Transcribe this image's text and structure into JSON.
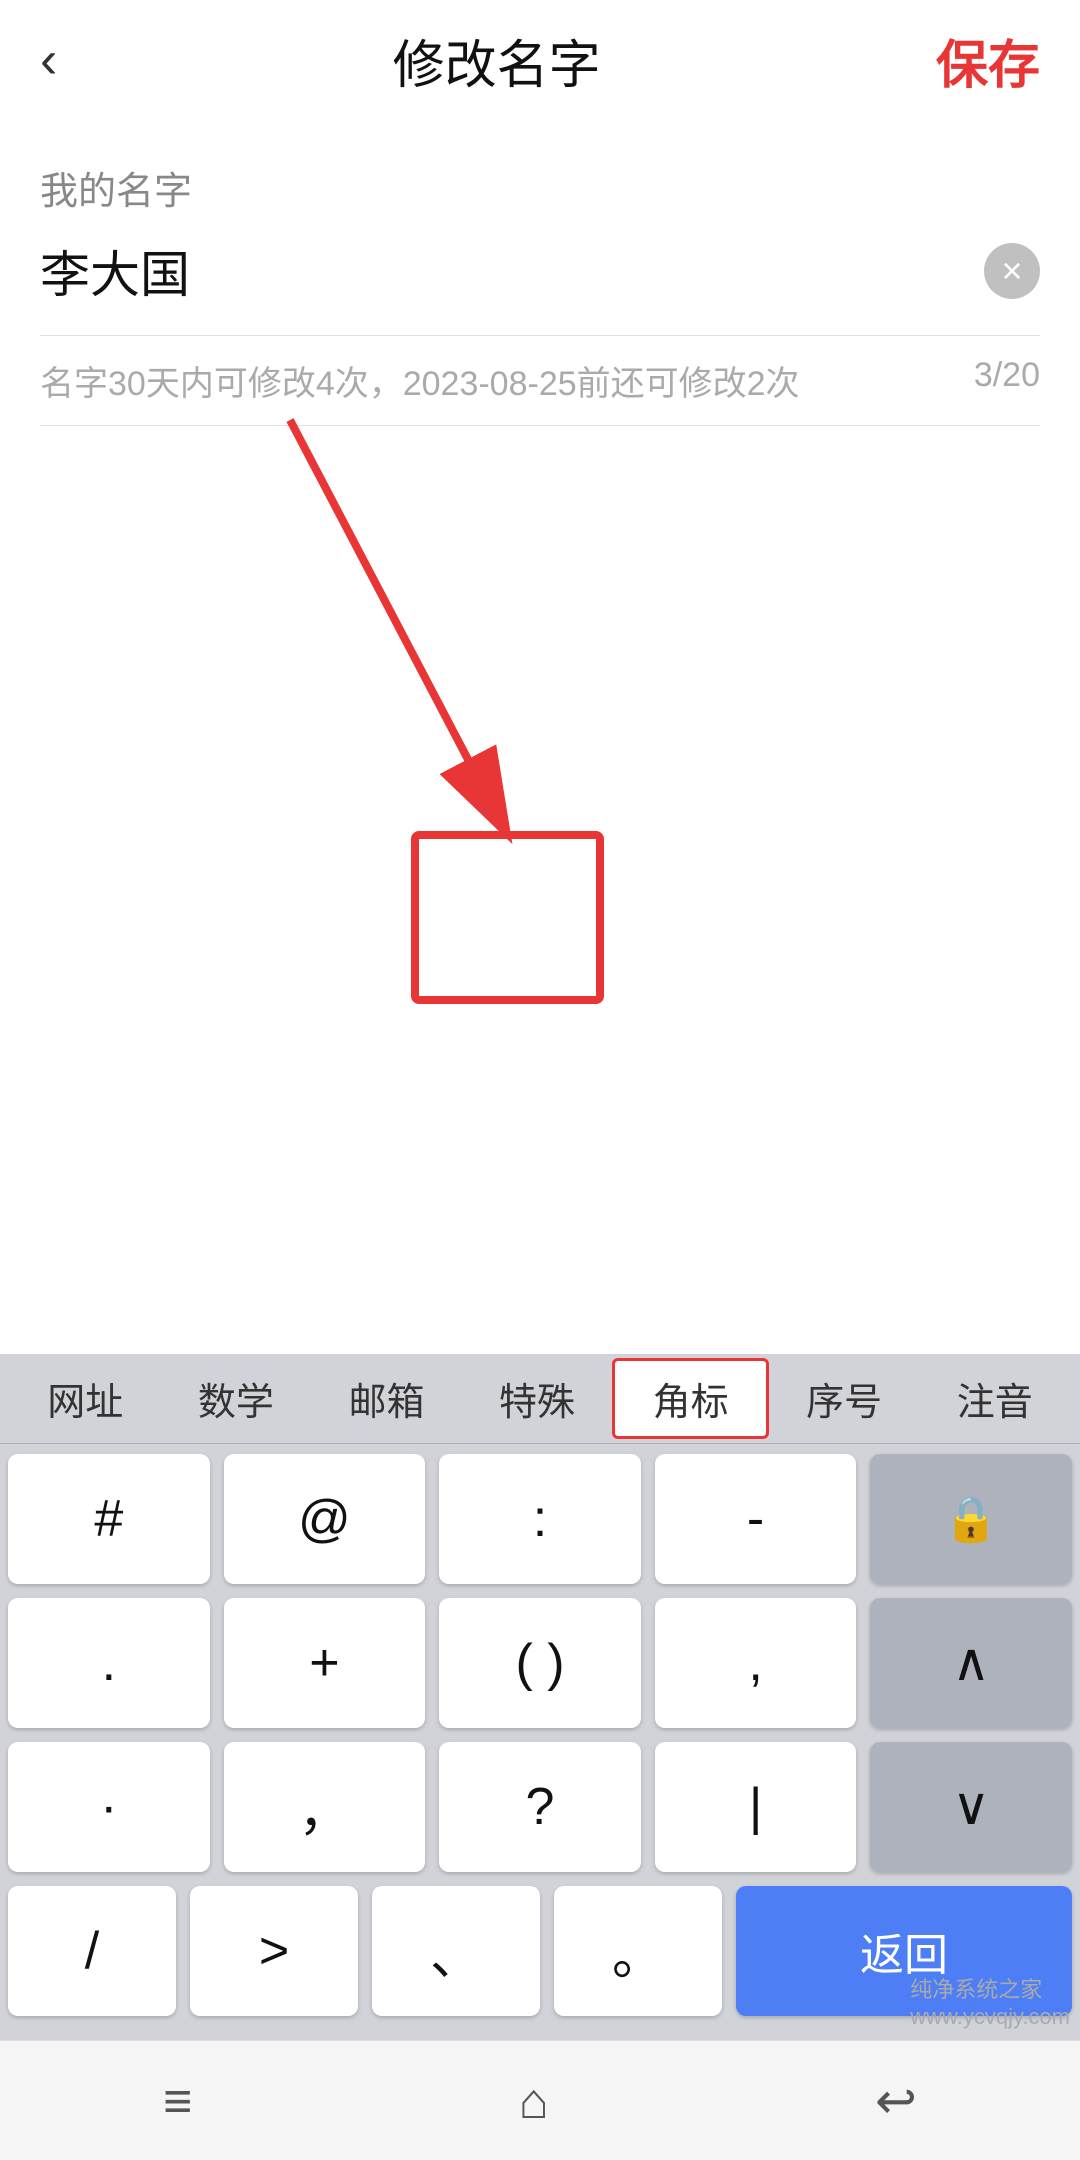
{
  "header": {
    "back_label": "‹",
    "title": "修改名字",
    "save_label": "保存"
  },
  "form": {
    "field_label": "我的名字",
    "field_value": "李大国",
    "hint_text": "名字30天内可修改4次，2023-08-25前还可修改2次",
    "char_count": "3/20"
  },
  "keyboard": {
    "topbar_items": [
      "网址",
      "数学",
      "邮箱",
      "特殊",
      "角标",
      "序号",
      "注音"
    ],
    "active_item_index": 4,
    "rows": [
      [
        "#",
        "@",
        ":",
        "–",
        "🔒"
      ],
      [
        ".",
        "+",
        "( )",
        ",",
        "↑"
      ],
      [
        "·",
        "，",
        "?",
        "|",
        "↓"
      ],
      [
        "/",
        ">",
        "、",
        "。",
        "返回"
      ]
    ]
  },
  "nav_bar": {
    "menu_icon": "≡",
    "home_icon": "⌂",
    "back_icon": "↩"
  },
  "annotation": {
    "arrow_color": "#e83535",
    "box_color": "#e83535"
  }
}
